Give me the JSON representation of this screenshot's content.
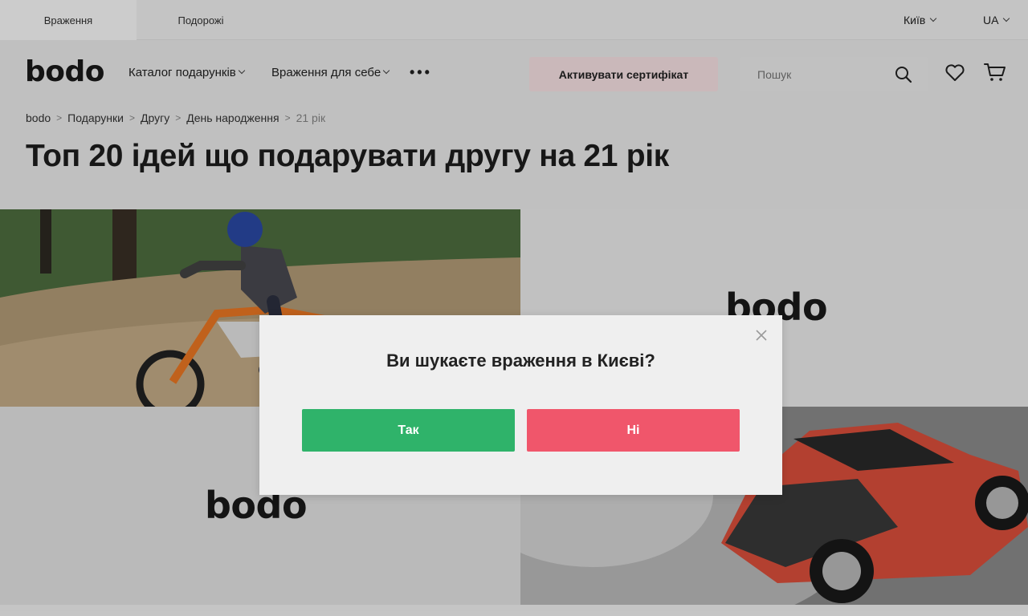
{
  "top_tabs": [
    {
      "label": "Враження"
    },
    {
      "label": "Подорожі"
    }
  ],
  "city_selector": {
    "value": "Київ"
  },
  "language_selector": {
    "value": "UA"
  },
  "logo": {
    "text": "bodo"
  },
  "nav": {
    "catalog": "Каталог подарунків",
    "self_experiences": "Враження для себе",
    "more": "•••"
  },
  "activate_button": {
    "label": "Активувати сертифікат"
  },
  "search": {
    "placeholder": "Пошук",
    "value": ""
  },
  "breadcrumb": [
    "bodo",
    "Подарунки",
    "Другу",
    "День народження",
    "21 рік"
  ],
  "page_title": "Топ 20 ідей що подарувати другу на 21 рік",
  "tiles": [
    {
      "type": "photo",
      "icon": "motocross-photo"
    },
    {
      "type": "placeholder",
      "logo": "bodo"
    },
    {
      "type": "placeholder",
      "logo": "bodo"
    },
    {
      "type": "photo",
      "icon": "drift-car-photo"
    }
  ],
  "modal": {
    "title": "Ви шукаєте враження в Києві?",
    "yes_label": "Так",
    "no_label": "Ні"
  },
  "colors": {
    "accent_yes": "#2fb36a",
    "accent_no": "#f0566b",
    "activate_bg": "#fde6e9",
    "text": "#1d1d1d"
  }
}
